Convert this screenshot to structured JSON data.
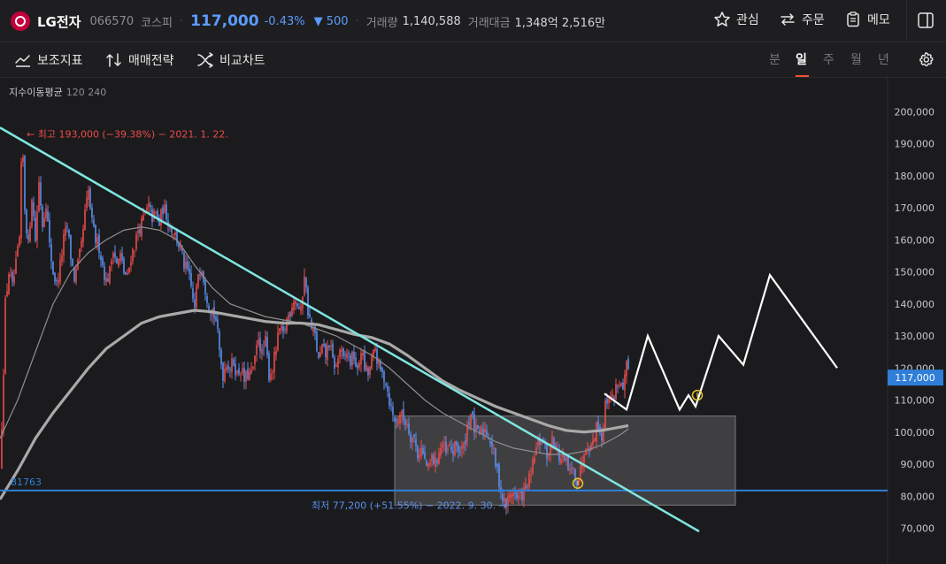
{
  "header": {
    "name": "LG전자",
    "code": "066570",
    "market": "코스피",
    "price": "117,000",
    "change_pct": "-0.43%",
    "change_amt": "▼ 500",
    "volume_label": "거래량",
    "volume": "1,140,588",
    "amount_label": "거래대금",
    "amount": "1,348억 2,516만",
    "watch_label": "관심",
    "order_label": "주문",
    "memo_label": "메모"
  },
  "toolbar": {
    "indicators_label": "보조지표",
    "strategy_label": "매매전략",
    "compare_label": "비교차트",
    "periods": [
      "분",
      "일",
      "주",
      "월",
      "년"
    ],
    "active_period": "일"
  },
  "colors": {
    "up": "#ec4b4b",
    "down": "#5b8fef",
    "trendline": "#7fe6e1",
    "support": "#2f7fd8",
    "ma120": "#8e8e8e",
    "ma240": "#a9a9a9",
    "projection": "#ffffff",
    "highlight_circle": "#e8c624",
    "price_tag_bg": "#2f7fd8"
  },
  "chart_data": {
    "type": "candlestick",
    "indicator_label": "지수이동평균",
    "indicator_params": "120 240",
    "yticks": [
      "200,000",
      "190,000",
      "180,000",
      "170,000",
      "160,000",
      "150,000",
      "140,000",
      "130,000",
      "120,000",
      "110,000",
      "100,000",
      "90,000",
      "80,000",
      "70,000"
    ],
    "ylim": [
      64000,
      205000
    ],
    "current_price": 117000,
    "current_price_label": "117,000",
    "high_annotation": "← 최고 193,000 (−39.38%) − 2021. 1. 22.",
    "low_annotation": "최저 77,200 (+51.55%) − 2022. 9. 30. →",
    "support_level": 81763,
    "support_label": "81763",
    "price_path": [
      [
        0,
        88000
      ],
      [
        3,
        110000
      ],
      [
        6,
        140000
      ],
      [
        10,
        150000
      ],
      [
        14,
        145000
      ],
      [
        18,
        152000
      ],
      [
        22,
        160000
      ],
      [
        25,
        193000
      ],
      [
        28,
        170000
      ],
      [
        32,
        158000
      ],
      [
        36,
        174000
      ],
      [
        40,
        160000
      ],
      [
        44,
        178000
      ],
      [
        48,
        165000
      ],
      [
        52,
        172000
      ],
      [
        56,
        158000
      ],
      [
        60,
        150000
      ],
      [
        64,
        146000
      ],
      [
        68,
        152000
      ],
      [
        72,
        160000
      ],
      [
        76,
        164000
      ],
      [
        80,
        155000
      ],
      [
        84,
        148000
      ],
      [
        88,
        152000
      ],
      [
        92,
        158000
      ],
      [
        96,
        168000
      ],
      [
        100,
        175000
      ],
      [
        104,
        165000
      ],
      [
        108,
        160000
      ],
      [
        112,
        158000
      ],
      [
        116,
        152000
      ],
      [
        120,
        147000
      ],
      [
        124,
        150000
      ],
      [
        128,
        158000
      ],
      [
        132,
        152000
      ],
      [
        136,
        155000
      ],
      [
        140,
        150000
      ],
      [
        144,
        148000
      ],
      [
        148,
        155000
      ],
      [
        152,
        158000
      ],
      [
        156,
        163000
      ],
      [
        160,
        165000
      ],
      [
        164,
        168000
      ],
      [
        168,
        170000
      ],
      [
        172,
        167000
      ],
      [
        176,
        168000
      ],
      [
        180,
        165000
      ],
      [
        184,
        170000
      ],
      [
        188,
        168000
      ],
      [
        192,
        164000
      ],
      [
        196,
        163000
      ],
      [
        200,
        160000
      ],
      [
        204,
        157000
      ],
      [
        208,
        152000
      ],
      [
        212,
        150000
      ],
      [
        216,
        145000
      ],
      [
        220,
        138000
      ],
      [
        224,
        150000
      ],
      [
        228,
        152000
      ],
      [
        232,
        145000
      ],
      [
        236,
        140000
      ],
      [
        240,
        138000
      ],
      [
        244,
        135000
      ],
      [
        248,
        125000
      ],
      [
        252,
        118000
      ],
      [
        256,
        122000
      ],
      [
        260,
        120000
      ],
      [
        264,
        122000
      ],
      [
        268,
        118000
      ],
      [
        272,
        120000
      ],
      [
        276,
        116000
      ],
      [
        280,
        118000
      ],
      [
        284,
        118000
      ],
      [
        288,
        122000
      ],
      [
        292,
        130000
      ],
      [
        296,
        124000
      ],
      [
        300,
        128000
      ],
      [
        304,
        118000
      ],
      [
        308,
        120000
      ],
      [
        312,
        126000
      ],
      [
        316,
        132000
      ],
      [
        320,
        130000
      ],
      [
        324,
        135000
      ],
      [
        328,
        138000
      ],
      [
        332,
        142000
      ],
      [
        336,
        140000
      ],
      [
        340,
        137000
      ],
      [
        344,
        150000
      ],
      [
        348,
        138000
      ],
      [
        352,
        132000
      ],
      [
        356,
        130000
      ],
      [
        360,
        122000
      ],
      [
        364,
        126000
      ],
      [
        368,
        124000
      ],
      [
        372,
        128000
      ],
      [
        376,
        122000
      ],
      [
        380,
        120000
      ],
      [
        384,
        126000
      ],
      [
        388,
        122000
      ],
      [
        392,
        125000
      ],
      [
        396,
        122000
      ],
      [
        400,
        124000
      ],
      [
        404,
        118000
      ],
      [
        408,
        126000
      ],
      [
        412,
        120000
      ],
      [
        416,
        118000
      ],
      [
        420,
        122000
      ],
      [
        424,
        126000
      ],
      [
        428,
        120000
      ],
      [
        432,
        118000
      ],
      [
        436,
        116000
      ],
      [
        440,
        110000
      ],
      [
        444,
        105000
      ],
      [
        448,
        103000
      ],
      [
        452,
        106000
      ],
      [
        456,
        104000
      ],
      [
        460,
        103000
      ],
      [
        464,
        99000
      ],
      [
        468,
        98000
      ],
      [
        472,
        93000
      ],
      [
        476,
        95000
      ],
      [
        480,
        91000
      ],
      [
        484,
        88000
      ],
      [
        488,
        92000
      ],
      [
        492,
        90000
      ],
      [
        496,
        94000
      ],
      [
        500,
        96000
      ],
      [
        504,
        93000
      ],
      [
        508,
        95000
      ],
      [
        512,
        94000
      ],
      [
        516,
        96000
      ],
      [
        520,
        94000
      ],
      [
        524,
        95000
      ],
      [
        528,
        102000
      ],
      [
        532,
        106000
      ],
      [
        536,
        101000
      ],
      [
        540,
        99000
      ],
      [
        544,
        100000
      ],
      [
        548,
        101000
      ],
      [
        552,
        99000
      ],
      [
        556,
        96000
      ],
      [
        560,
        90000
      ],
      [
        564,
        85000
      ],
      [
        568,
        79000
      ],
      [
        572,
        77200
      ],
      [
        576,
        80000
      ],
      [
        580,
        82000
      ],
      [
        584,
        79000
      ],
      [
        588,
        80000
      ],
      [
        592,
        81000
      ],
      [
        596,
        84000
      ],
      [
        600,
        86000
      ],
      [
        604,
        93000
      ],
      [
        608,
        96000
      ],
      [
        612,
        98000
      ],
      [
        616,
        95000
      ],
      [
        620,
        92000
      ],
      [
        624,
        100000
      ],
      [
        628,
        95000
      ],
      [
        632,
        92000
      ],
      [
        636,
        91000
      ],
      [
        640,
        90000
      ],
      [
        644,
        87000
      ],
      [
        648,
        88000
      ],
      [
        652,
        85000
      ],
      [
        656,
        88000
      ],
      [
        660,
        95000
      ],
      [
        664,
        97000
      ],
      [
        668,
        95000
      ],
      [
        672,
        100000
      ],
      [
        676,
        103000
      ],
      [
        680,
        98000
      ],
      [
        684,
        108000
      ],
      [
        688,
        112000
      ],
      [
        692,
        110000
      ],
      [
        696,
        114000
      ],
      [
        700,
        116000
      ],
      [
        704,
        112000
      ],
      [
        708,
        120000
      ],
      [
        711,
        117000
      ]
    ],
    "ma120": [
      [
        0,
        98000
      ],
      [
        20,
        110000
      ],
      [
        40,
        125000
      ],
      [
        60,
        140000
      ],
      [
        80,
        150000
      ],
      [
        100,
        156000
      ],
      [
        120,
        160000
      ],
      [
        140,
        163000
      ],
      [
        160,
        164000
      ],
      [
        180,
        163000
      ],
      [
        200,
        160000
      ],
      [
        220,
        152000
      ],
      [
        240,
        145000
      ],
      [
        260,
        140000
      ],
      [
        280,
        138000
      ],
      [
        300,
        136000
      ],
      [
        320,
        135000
      ],
      [
        340,
        134000
      ],
      [
        360,
        132000
      ],
      [
        380,
        130000
      ],
      [
        400,
        127000
      ],
      [
        420,
        124000
      ],
      [
        440,
        120000
      ],
      [
        460,
        115000
      ],
      [
        480,
        110000
      ],
      [
        500,
        106000
      ],
      [
        520,
        103000
      ],
      [
        540,
        100000
      ],
      [
        560,
        97000
      ],
      [
        580,
        95000
      ],
      [
        600,
        94000
      ],
      [
        620,
        93000
      ],
      [
        640,
        93000
      ],
      [
        660,
        94000
      ],
      [
        680,
        96000
      ],
      [
        700,
        99000
      ],
      [
        710,
        101000
      ]
    ],
    "ma240": [
      [
        0,
        79000
      ],
      [
        20,
        88000
      ],
      [
        40,
        98000
      ],
      [
        60,
        106000
      ],
      [
        80,
        113000
      ],
      [
        100,
        120000
      ],
      [
        120,
        126000
      ],
      [
        140,
        130000
      ],
      [
        160,
        134000
      ],
      [
        180,
        136000
      ],
      [
        200,
        137000
      ],
      [
        220,
        138000
      ],
      [
        240,
        137500
      ],
      [
        260,
        136500
      ],
      [
        280,
        135500
      ],
      [
        300,
        134500
      ],
      [
        320,
        134000
      ],
      [
        340,
        134000
      ],
      [
        360,
        133500
      ],
      [
        380,
        132000
      ],
      [
        400,
        130500
      ],
      [
        420,
        129500
      ],
      [
        440,
        127500
      ],
      [
        460,
        124000
      ],
      [
        480,
        120000
      ],
      [
        500,
        116000
      ],
      [
        520,
        113000
      ],
      [
        540,
        110500
      ],
      [
        560,
        108000
      ],
      [
        580,
        106000
      ],
      [
        600,
        104000
      ],
      [
        620,
        102000
      ],
      [
        640,
        100500
      ],
      [
        660,
        100000
      ],
      [
        680,
        100500
      ],
      [
        700,
        101500
      ],
      [
        710,
        102000
      ]
    ],
    "trendline": [
      [
        0,
        195000
      ],
      [
        790,
        69000
      ]
    ],
    "projection": [
      [
        683,
        112000
      ],
      [
        708,
        107000
      ],
      [
        732,
        130000
      ],
      [
        768,
        107000
      ],
      [
        778,
        111500
      ],
      [
        786,
        108000
      ],
      [
        812,
        130000
      ],
      [
        840,
        121000
      ],
      [
        870,
        149000
      ],
      [
        946,
        120000
      ]
    ],
    "highlight_circles": [
      [
        653,
        84000
      ],
      [
        788,
        111500
      ]
    ],
    "box": {
      "x_from": 446,
      "x_to": 831,
      "y_low": 77200,
      "y_high": 105000
    }
  }
}
